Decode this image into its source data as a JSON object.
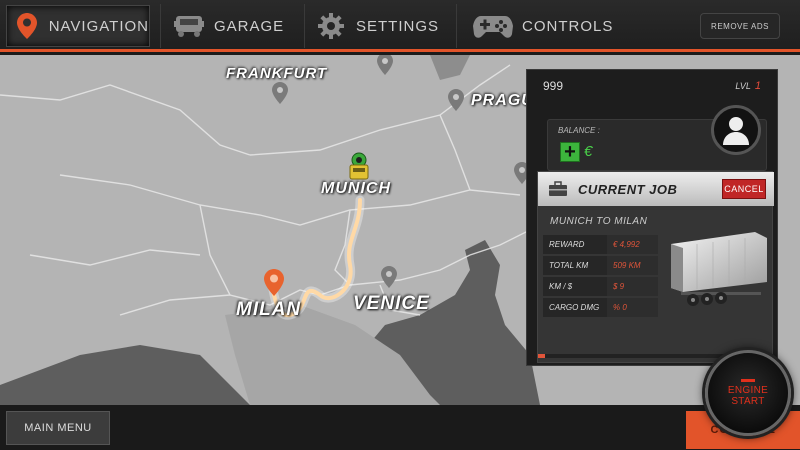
{
  "nav": {
    "items": [
      {
        "label": "NAVIGATION",
        "icon": "map-pin-icon"
      },
      {
        "label": "GARAGE",
        "icon": "truck-icon"
      },
      {
        "label": "SETTINGS",
        "icon": "gear-icon"
      },
      {
        "label": "CONTROLS",
        "icon": "gamepad-icon"
      }
    ],
    "remove_ads": "REMOVE ADS"
  },
  "map": {
    "cities": {
      "frankfurt": "FRANKFURT",
      "prague": "PRAGUE",
      "munich": "MUNICH",
      "milan": "MILAN",
      "venice": "VENICE"
    }
  },
  "panel": {
    "money": "999",
    "level_label": "LVL",
    "level_value": "1",
    "balance_label": "BALANCE :",
    "balance_add": "+",
    "currency": "€",
    "job": {
      "title": "CURRENT JOB",
      "cancel": "CANCEL",
      "route": "MUNICH TO MILAN",
      "rows": [
        {
          "key": "REWARD",
          "value": "€ 4,992"
        },
        {
          "key": "TOTAL KM",
          "value": "509 KM"
        },
        {
          "key": "KM / $",
          "value": "$ 9"
        },
        {
          "key": "CARGO DMG",
          "value": "% 0"
        }
      ],
      "progress": 0.01
    }
  },
  "bottom": {
    "main_menu": "MAIN MENU",
    "continue": "CONTINUE",
    "engine_line1": "ENGINE",
    "engine_line2": "START"
  },
  "colors": {
    "accent": "#e2542a",
    "map_land": "#b4b4b4",
    "map_sea": "#5e5e5e",
    "positive": "#3cb43c",
    "danger": "#c02626"
  }
}
